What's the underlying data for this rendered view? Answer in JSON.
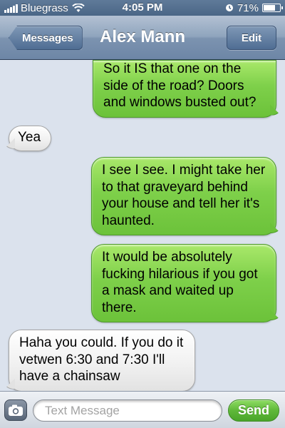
{
  "status_bar": {
    "carrier": "Bluegrass",
    "time": "4:05 PM",
    "battery_percent": "71%",
    "battery_level": 0.71,
    "signal_icon": "signal-bars-icon",
    "wifi_icon": "wifi-icon",
    "alarm_icon": "alarm-icon",
    "battery_icon": "battery-icon"
  },
  "nav": {
    "back_label": "Messages",
    "title": "Alex Mann",
    "edit_label": "Edit"
  },
  "messages": [
    {
      "direction": "out",
      "text": "So it IS that one on the side of the road? Doors and windows busted out?"
    },
    {
      "direction": "in",
      "text": "Yea"
    },
    {
      "direction": "out",
      "text": "I see I see. I might take her to that graveyard behind your house and tell her it's haunted."
    },
    {
      "direction": "out",
      "text": "It would be absolutely fucking hilarious if you got a mask and waited up there."
    },
    {
      "direction": "in",
      "text": "Haha you could. If you do it vetwen 6:30 and 7:30 I'll have a chainsaw"
    }
  ],
  "input_bar": {
    "camera_icon": "camera-icon",
    "placeholder": "Text Message",
    "send_label": "Send"
  },
  "colors": {
    "outgoing_bubble": "#7ed04a",
    "incoming_bubble": "#f1f1f1",
    "nav_bar": "#7c93b0",
    "background": "#dbe2ed"
  }
}
